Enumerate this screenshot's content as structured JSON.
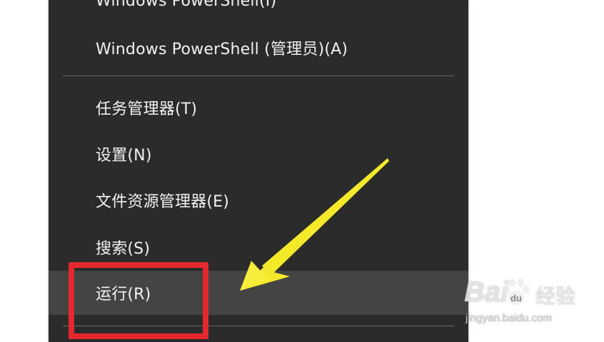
{
  "menu": {
    "items": [
      {
        "label": "Windows PowerShell(I)"
      },
      {
        "label": "Windows PowerShell (管理员)(A)"
      },
      {
        "label": "任务管理器(T)"
      },
      {
        "label": "设置(N)"
      },
      {
        "label": "文件资源管理器(E)"
      },
      {
        "label": "搜索(S)"
      },
      {
        "label": "运行(R)"
      }
    ],
    "highlighted_item": "运行(R)"
  },
  "annotation": {
    "box_color": "#e4282e",
    "arrow_color": "#f4ea2a"
  },
  "watermark": {
    "brand": "Bai",
    "brand_suffix": "经验",
    "url": "jingyan.baidu.com"
  }
}
